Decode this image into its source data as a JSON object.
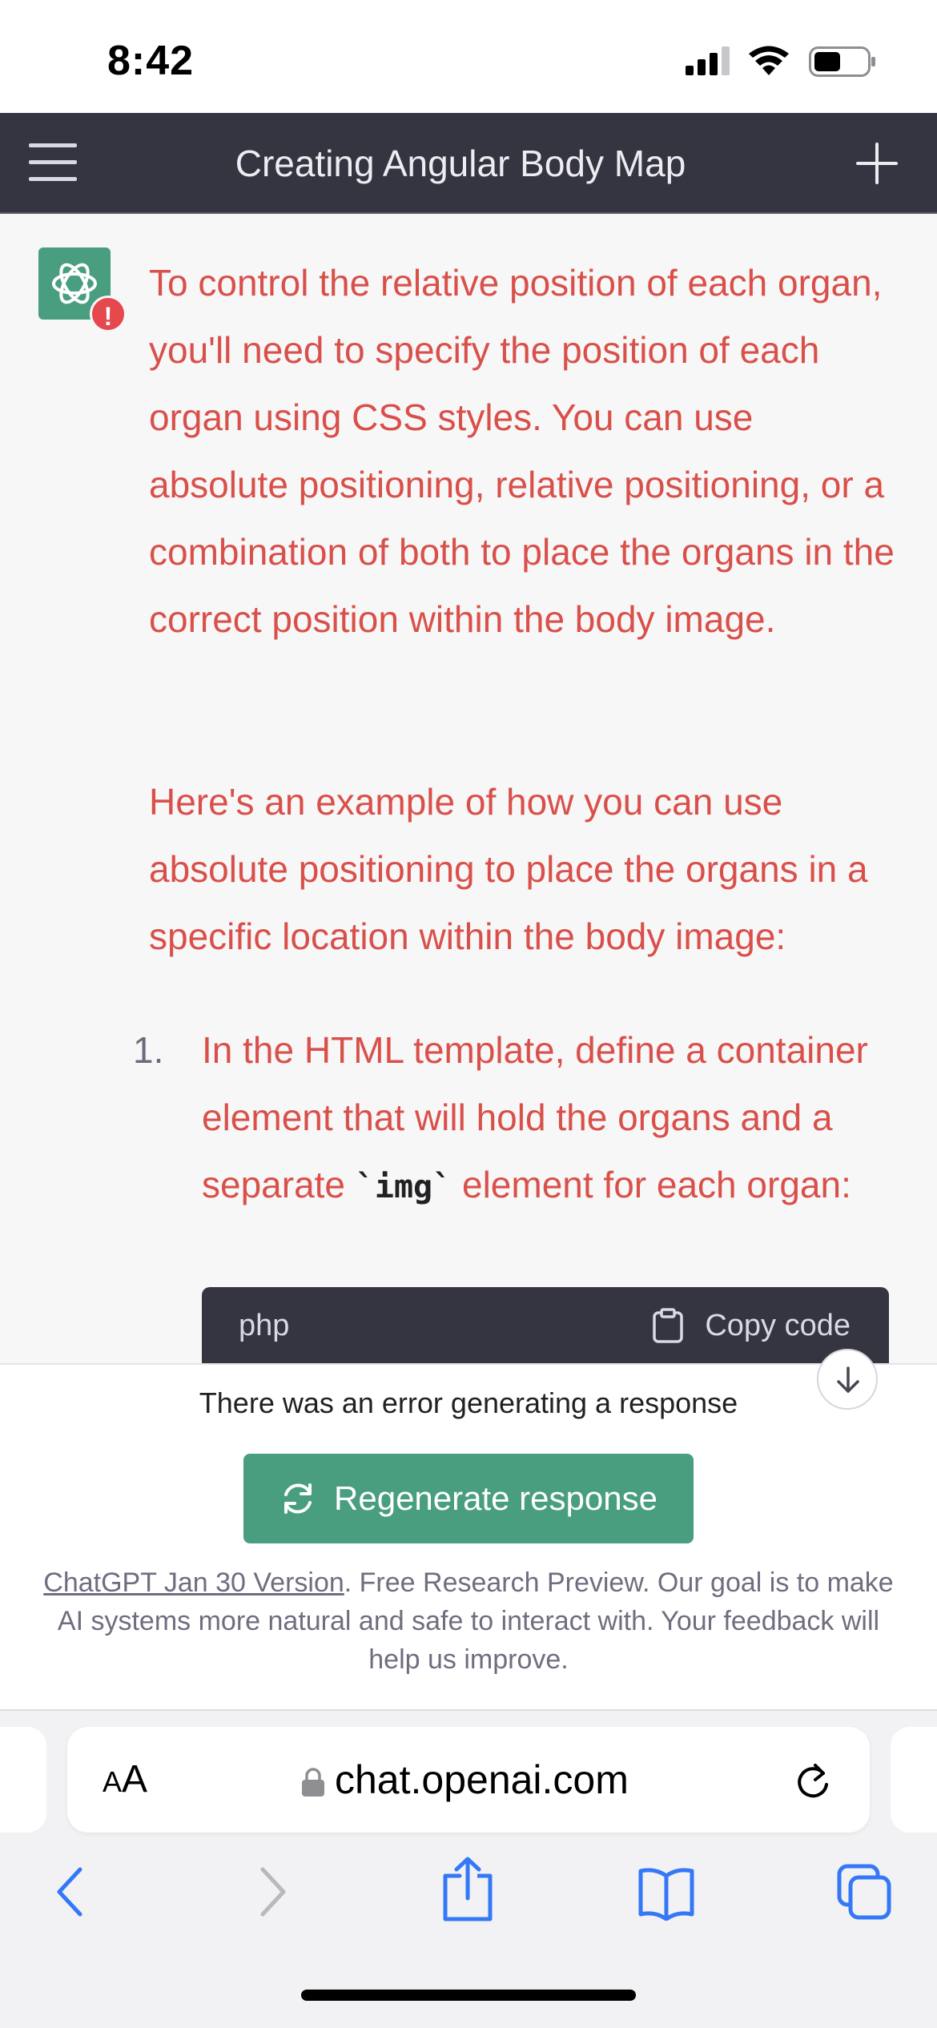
{
  "status_bar": {
    "time": "8:42"
  },
  "header": {
    "title": "Creating Angular Body Map"
  },
  "message": {
    "paragraph_1": "To control the relative position of each organ, you'll need to specify the position of each organ using CSS styles. You can use absolute positioning, relative positioning, or a combination of both to place the organs in the correct position within the body image.",
    "paragraph_2": "Here's an example of how you can use absolute positioning to place the organs in a specific location within the body image:",
    "list_item_1": {
      "number": "1.",
      "text_before": "In the HTML template, define a container element that will hold the organs and a separate ",
      "code": "`img`",
      "text_after": " element for each organ:"
    },
    "code_block": {
      "language": "php",
      "copy_label": "Copy code"
    }
  },
  "bottom_panel": {
    "error_text": "There was an error generating a response",
    "regenerate_label": "Regenerate response",
    "footer_link": "ChatGPT Jan 30 Version",
    "footer_text": ". Free Research Preview. Our goal is to make AI systems more natural and safe to interact with. Your feedback will help us improve."
  },
  "safari": {
    "aa_label_small": "A",
    "aa_label_large": "A",
    "url": "chat.openai.com"
  },
  "colors": {
    "accent_green": "#4a9e80",
    "error_red": "#d9504a",
    "header_bg": "#343541"
  },
  "icons": [
    "menu-icon",
    "plus-icon",
    "chatgpt-logo-icon",
    "error-icon",
    "clipboard-icon",
    "arrow-down-icon",
    "refresh-icon",
    "lock-icon",
    "reload-icon",
    "back-icon",
    "forward-icon",
    "share-icon",
    "bookmarks-icon",
    "tabs-icon"
  ]
}
